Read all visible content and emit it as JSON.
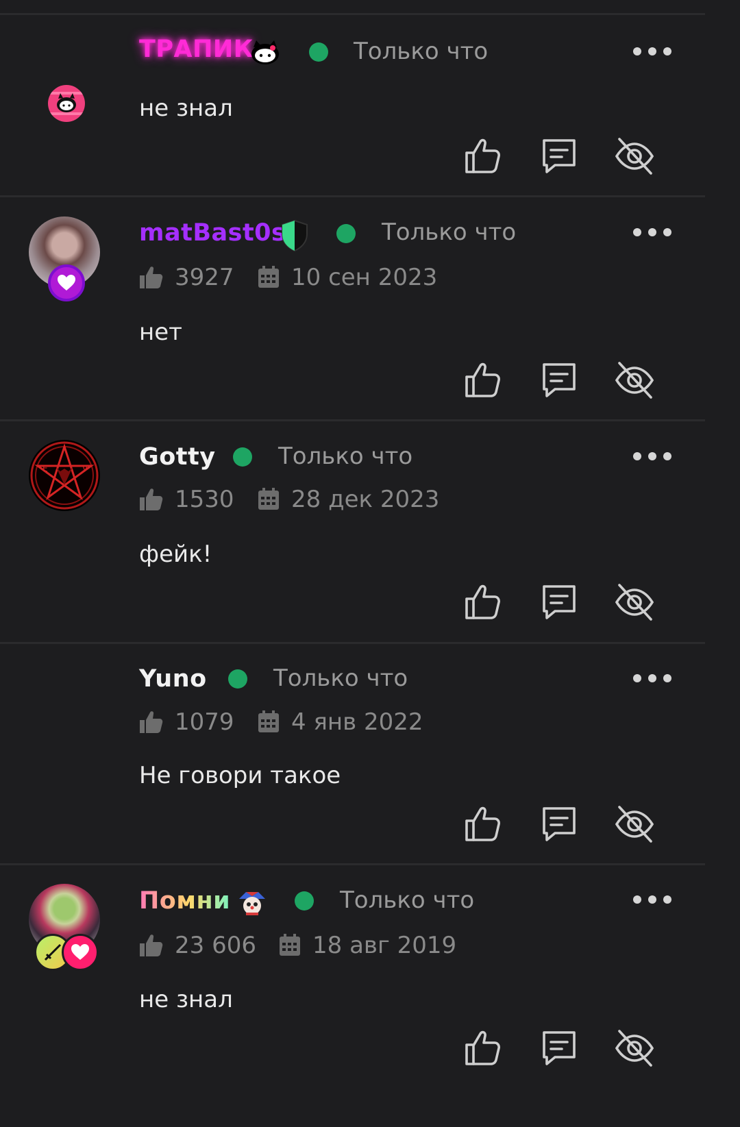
{
  "comments": [
    {
      "username": "ТРАПИК",
      "name_color": "#ff2bd6",
      "name_deco_icon": "hello-kitty-icon",
      "time": "Только что",
      "text": "не знал",
      "avatar_icon": "hello-kitty-avatar-icon"
    },
    {
      "username": "matBast0s",
      "name_color": "#a52fff",
      "name_deco_icon": "shield-icon",
      "time": "Только что",
      "likes": "3927",
      "date": "10 сен 2023",
      "text": "нет",
      "avatar_icon": "photo-avatar",
      "badge_icon": "heart-badge-icon"
    },
    {
      "username": "Gotty",
      "name_color": "#f2f2f2",
      "time": "Только что",
      "likes": "1530",
      "date": "28 дек 2023",
      "text": "фейк!",
      "avatar_icon": "pentagram-avatar"
    },
    {
      "username": "Yuno",
      "name_color": "#f2f2f2",
      "time": "Только что",
      "likes": "1079",
      "date": "4 янв 2022",
      "text": "Не говори такое"
    },
    {
      "username": "Помни",
      "name_color_gradient": [
        "#ff7ab6",
        "#ffd86b",
        "#7cf3c0"
      ],
      "name_deco_icon": "clown-icon",
      "time": "Только что",
      "likes": "23 606",
      "date": "18 авг 2019",
      "text": "не знал",
      "avatar_icon": "anime-avatar",
      "badge_icon": "heart-badge-icon"
    }
  ],
  "icons": {
    "like": "thumbs-up-icon",
    "reply": "comment-icon",
    "hide": "eye-off-icon",
    "more": "more-dots-icon",
    "likes_stat": "thumb-stat-icon",
    "date_stat": "calendar-icon"
  }
}
